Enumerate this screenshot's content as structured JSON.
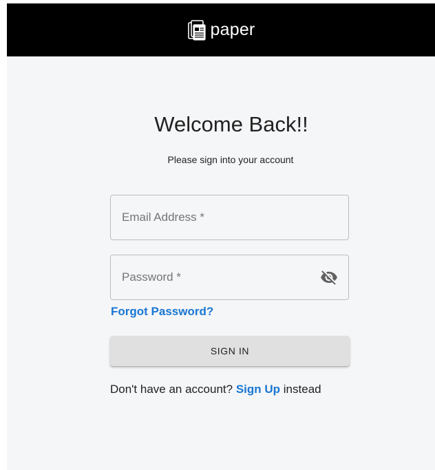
{
  "header": {
    "brand_name": "paper",
    "brand_icon": "document-stack-icon",
    "background": "#000000"
  },
  "login": {
    "title": "Welcome Back!!",
    "subtitle": "Please sign into your account",
    "email_placeholder": "Email Address *",
    "email_value": "",
    "password_placeholder": "Password *",
    "password_value": "",
    "password_toggle_icon": "eye-off-icon",
    "forgot_label": "Forgot Password?",
    "signin_label": "SIGN IN",
    "signup_prefix": "Don't have an account?",
    "signup_link": "Sign Up",
    "signup_suffix": "instead"
  },
  "colors": {
    "accent": "#1976d2",
    "page_background": "#f5f6f8",
    "button_background": "#e0e0e0"
  }
}
